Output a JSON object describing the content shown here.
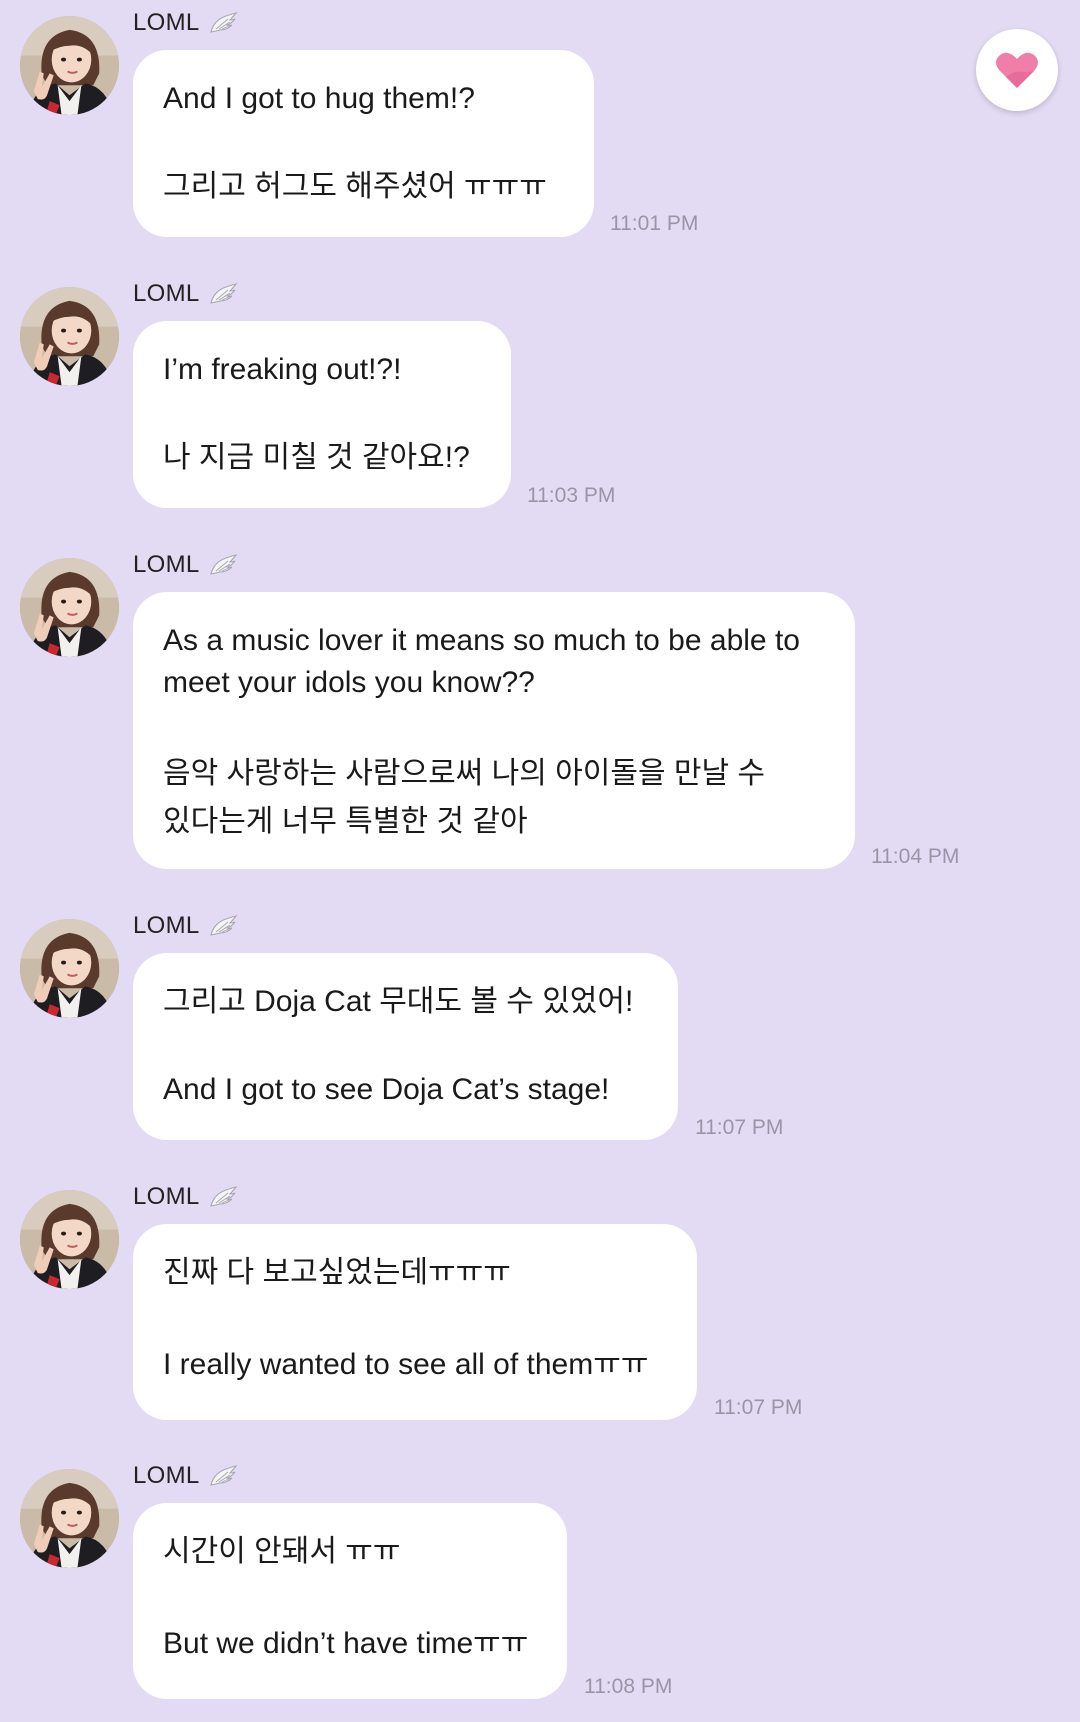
{
  "colors": {
    "background": "#e3dbf4",
    "bubble": "#ffffff",
    "timestamp": "#9a95a6",
    "heart": "#ef7fa8"
  },
  "icons": {
    "heart_button": "heart-icon",
    "sender_badge": "wing-icon"
  },
  "messages": [
    {
      "sender": "LOML",
      "line1": "And I got to hug them!?",
      "line2": "그리고 허그도 해주셨어 ㅠㅠㅠ",
      "time": "11:01 PM"
    },
    {
      "sender": "LOML",
      "line1": "I’m freaking out!?!",
      "line2": "나 지금 미칠 것 같아요!?",
      "time": "11:03 PM"
    },
    {
      "sender": "LOML",
      "line1a": "As a music lover it means so much to be able to",
      "line1b": "meet your idols you know??",
      "line2a": "음악 사랑하는 사람으로써 나의 아이돌을 만날 수",
      "line2b": "있다는게 너무 특별한 것 같아",
      "time": "11:04 PM"
    },
    {
      "sender": "LOML",
      "line1": "그리고 Doja Cat 무대도 볼 수 있었어!",
      "line2": "And I got to see Doja Cat’s stage!",
      "time": "11:07 PM"
    },
    {
      "sender": "LOML",
      "line1": "진짜 다 보고싶었는데ㅠㅠㅠ",
      "line2": "I really wanted to see all of themㅠㅠ",
      "time": "11:07 PM"
    },
    {
      "sender": "LOML",
      "line1": "시간이 안돼서 ㅠㅠ",
      "line2": "But we didn’t have timeㅠㅠ",
      "time": "11:08 PM"
    }
  ]
}
